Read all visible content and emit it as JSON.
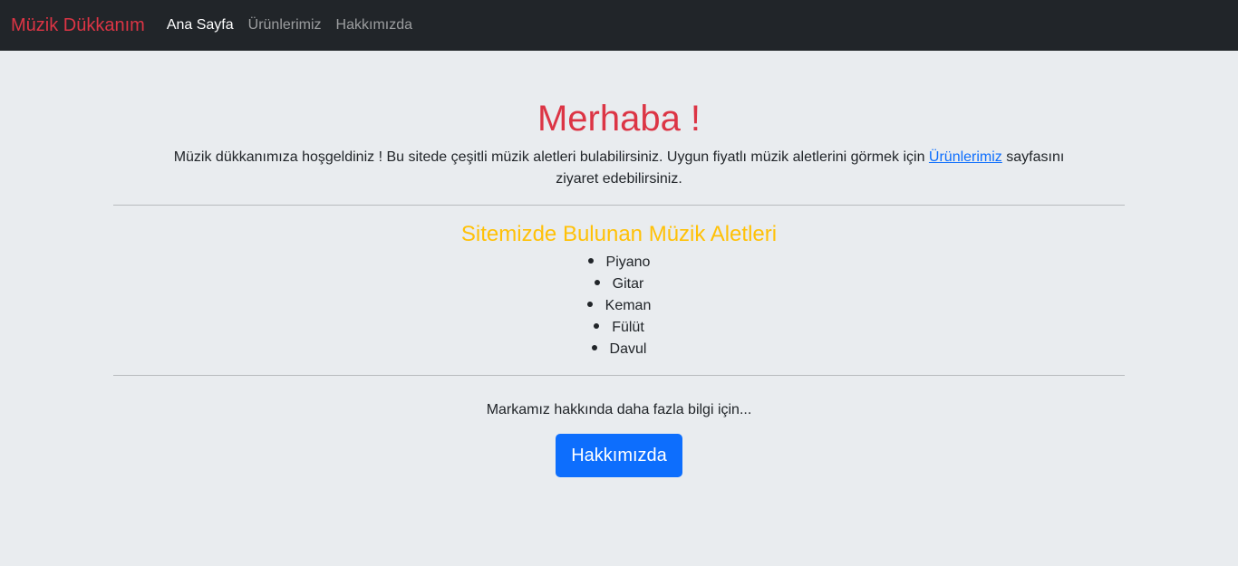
{
  "navbar": {
    "brand": "Müzik Dükkanım",
    "links": [
      {
        "label": "Ana Sayfa",
        "active": true
      },
      {
        "label": "Ürünlerimiz",
        "active": false
      },
      {
        "label": "Hakkımızda",
        "active": false
      }
    ]
  },
  "hero": {
    "title": "Merhaba !",
    "intro_before": "Müzik dükkanımıza hoşgeldiniz ! Bu sitede çeşitli müzik aletleri bulabilirsiniz. Uygun fiyatlı müzik aletlerini görmek için ",
    "intro_link": "Ürünlerimiz",
    "intro_after": " sayfasını ziyaret edebilirsiniz."
  },
  "instruments": {
    "heading": "Sitemizde Bulunan Müzik Aletleri",
    "items": [
      "Piyano",
      "Gitar",
      "Keman",
      "Fülüt",
      "Davul"
    ]
  },
  "about": {
    "text": "Markamız hakkında daha fazla bilgi için...",
    "button_label": "Hakkımızda"
  },
  "colors": {
    "navbar_bg": "#212529",
    "brand": "#dc3545",
    "title": "#dc3545",
    "heading": "#ffc107",
    "button": "#0d6efd",
    "page_bg": "#e9ecef"
  }
}
